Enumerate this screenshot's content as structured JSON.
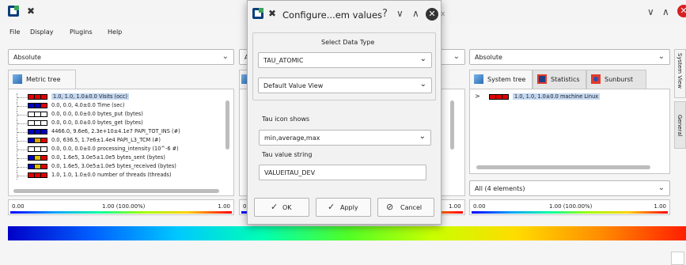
{
  "window": {
    "pin_glyph": "✖",
    "min_glyph": "∨",
    "max_glyph": "∧",
    "close_glyph": "✕"
  },
  "menu": [
    "File",
    "Display",
    "Plugins",
    "Help"
  ],
  "left_combo": "Absolute",
  "middle_combo": "A",
  "right_combo": "Absolute",
  "left_tab": "Metric tree",
  "tree_items": [
    {
      "text": "1.0, 1.0, 1.0±0.0 Visits (occ)",
      "colors": [
        "#e00000",
        "#e00000",
        "#e00000"
      ],
      "selected": true
    },
    {
      "text": "0.0, 0.0, 4.0±0.0 Time (sec)",
      "colors": [
        "#0000c0",
        "#0000c0",
        "#e00000"
      ],
      "selected": false
    },
    {
      "text": "0.0, 0.0, 0.0±0.0 bytes_put (bytes)",
      "colors": [
        "#ffffff",
        "#ffffff",
        "#ffffff"
      ],
      "selected": false
    },
    {
      "text": "0.0, 0.0, 0.0±0.0 bytes_get (bytes)",
      "colors": [
        "#ffffff",
        "#ffffff",
        "#ffffff"
      ],
      "selected": false
    },
    {
      "text": "4466.0, 9.6e6, 2.3e+10±4.1e7 PAPI_TOT_INS (#)",
      "colors": [
        "#0000c0",
        "#0000c0",
        "#0000c0"
      ],
      "selected": false
    },
    {
      "text": "0.0, 636.5, 1.7e6±1.4e4 PAPI_L3_TCM (#)",
      "colors": [
        "#0000c0",
        "#e0a000",
        "#e00000"
      ],
      "selected": false
    },
    {
      "text": "0.0, 0.0, 0.0±0.0 processing_intensity (10^-6 #)",
      "colors": [
        "#ffffff",
        "#ffffff",
        "#ffffff"
      ],
      "selected": false
    },
    {
      "text": "0.0, 1.6e5, 3.0e5±1.0e5 bytes_sent (bytes)",
      "colors": [
        "#0000c0",
        "#e0c000",
        "#e00000"
      ],
      "selected": false
    },
    {
      "text": "0.0, 1.6e5, 3.0e5±1.0e5 bytes_received (bytes)",
      "colors": [
        "#0000c0",
        "#e0c000",
        "#e00000"
      ],
      "selected": false
    },
    {
      "text": "1.0, 1.0, 1.0±0.0 number of threads (threads)",
      "colors": [
        "#e00000",
        "#e00000",
        "#e00000"
      ],
      "selected": false
    }
  ],
  "left_scale": {
    "min": "0.00",
    "mid": "1.00 (100.00%)",
    "max": "1.00"
  },
  "middle_scale": {
    "min": "0",
    "max": "1.00"
  },
  "right_tabs": [
    "System tree",
    "Statistics",
    "Sunburst"
  ],
  "system_tree_item": "1.0, 1.0, 1.0±0.0 machine Linux",
  "system_tree_expander": ">",
  "right_bottom_combo": "All (4 elements)",
  "right_scale": {
    "min": "0.00",
    "mid": "1.00 (100.00%)",
    "max": "1.00"
  },
  "side_tabs": [
    "System View",
    "General"
  ],
  "dialog": {
    "title": "Configure...em values",
    "title_tail": "x",
    "help_glyph": "?",
    "group_title": "Select Data Type",
    "data_type": "TAU_ATOMIC",
    "value_view": "Default Value View",
    "icon_label": "Tau icon shows",
    "icon_value": "min,average,max",
    "string_label": "Tau value string",
    "string_value": "VALUEITAU_DEV",
    "ok": "OK",
    "ok_icon": "✓",
    "apply": "Apply",
    "apply_icon": "✓",
    "cancel": "Cancel",
    "cancel_icon": "⊘"
  },
  "colors": {
    "accent": "#0a3e7c",
    "selection": "#c4d8f2"
  }
}
